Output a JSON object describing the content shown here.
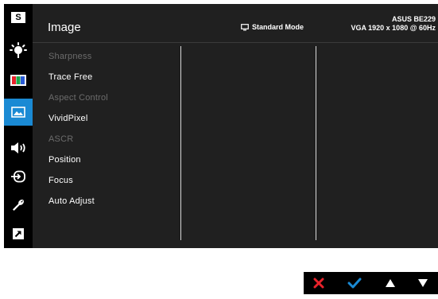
{
  "header": {
    "title": "Image",
    "mode": "Standard Mode",
    "model": "ASUS BE229",
    "signal": "VGA 1920 x 1080 @ 60Hz"
  },
  "sidebar": {
    "items": [
      {
        "name": "splendid-icon",
        "label": "S"
      },
      {
        "name": "blue-light-filter-icon"
      },
      {
        "name": "color-icon"
      },
      {
        "name": "image-icon",
        "active": true
      },
      {
        "name": "sound-icon"
      },
      {
        "name": "input-select-icon"
      },
      {
        "name": "system-setup-icon"
      },
      {
        "name": "shortcut-icon"
      }
    ]
  },
  "menu": {
    "items": [
      {
        "label": "Sharpness",
        "enabled": false
      },
      {
        "label": "Trace Free",
        "enabled": true
      },
      {
        "label": "Aspect Control",
        "enabled": false
      },
      {
        "label": "VividPixel",
        "enabled": true
      },
      {
        "label": "ASCR",
        "enabled": false
      },
      {
        "label": "Position",
        "enabled": true
      },
      {
        "label": "Focus",
        "enabled": true
      },
      {
        "label": "Auto Adjust",
        "enabled": true
      }
    ]
  },
  "nav": {
    "buttons": [
      {
        "name": "close-icon",
        "color": "#e8232b"
      },
      {
        "name": "check-icon",
        "color": "#1a8ad4"
      },
      {
        "name": "up-arrow-icon",
        "color": "#ffffff"
      },
      {
        "name": "down-arrow-icon",
        "color": "#ffffff"
      }
    ]
  }
}
